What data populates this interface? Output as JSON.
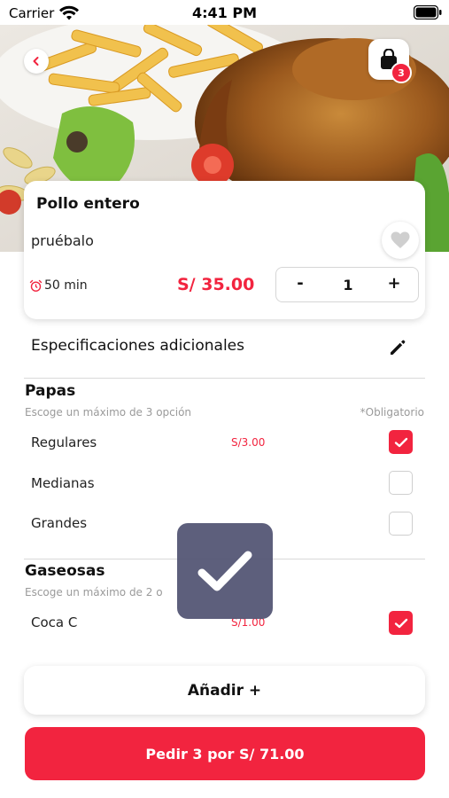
{
  "status_bar": {
    "carrier": "Carrier",
    "time": "4:41 PM"
  },
  "cart": {
    "badge_count": "3"
  },
  "product": {
    "title": "Pollo entero",
    "description": "pruébalo",
    "prep_time": "50 min",
    "price": "S/ 35.00",
    "quantity": "1",
    "minus_label": "-",
    "plus_label": "+"
  },
  "specs": {
    "label": "Especificaciones adicionales"
  },
  "sections": [
    {
      "title": "Papas",
      "hint": "Escoge un máximo de 3 opción",
      "required": "*Obligatorio",
      "options": [
        {
          "label": "Regulares",
          "price": "S/3.00",
          "checked": true
        },
        {
          "label": "Medianas",
          "price": "",
          "checked": false
        },
        {
          "label": "Grandes",
          "price": "",
          "checked": false
        }
      ]
    },
    {
      "title": "Gaseosas",
      "hint": "Escoge un máximo de 2 o",
      "options": [
        {
          "label": "Coca C",
          "price": "S/1.00",
          "checked": true
        }
      ]
    }
  ],
  "actions": {
    "add_label": "Añadir +",
    "order_label": "Pedir 3 por S/ 71.00"
  },
  "colors": {
    "accent": "#f2243f",
    "toast": "#545675"
  },
  "icons": [
    "wifi-icon",
    "battery-icon",
    "back-chevron-icon",
    "shopping-bag-icon",
    "heart-icon",
    "alarm-clock-icon",
    "pencil-icon",
    "checkmark-icon"
  ]
}
